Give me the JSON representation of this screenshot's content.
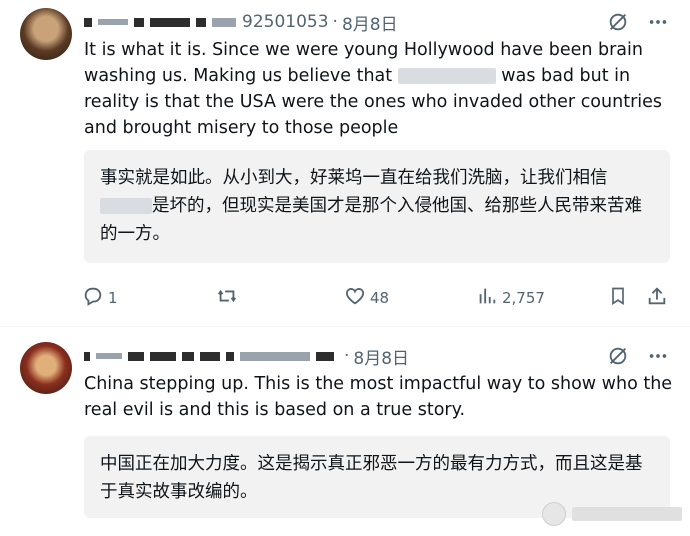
{
  "posts": [
    {
      "handle_visible": "92501053",
      "date": "8月8日",
      "text_parts": [
        "It is what it is.  Since we were young Hollywood have been brain washing us. Making us believe that ",
        " was bad but in reality is that the USA were the ones who invaded other countries and brought misery to those people"
      ],
      "translation_parts": [
        "事实就是如此。从小到大，好莱坞一直在给我们洗脑，让我们相信",
        "是坏的，但现实是美国才是那个入侵他国、给那些人民带来苦难的一方。"
      ],
      "actions": {
        "replies": "1",
        "reposts": "",
        "likes": "48",
        "views": "2,757"
      }
    },
    {
      "handle_visible": "",
      "date": "8月8日",
      "text": "China stepping up. This is the most impactful way to show who the real evil is and this is based on a true story.",
      "translation": "中国正在加大力度。这是揭示真正邪恶一方的最有力方式，而且这是基于真实故事改编的。"
    }
  ],
  "icons": {
    "grok": "grok-icon",
    "more": "more-icon",
    "reply": "reply-icon",
    "repost": "repost-icon",
    "like": "heart-icon",
    "views": "views-icon",
    "bookmark": "bookmark-icon",
    "share": "share-icon"
  },
  "colors": {
    "text": "#0f1419",
    "muted": "#536471",
    "translation_bg": "#f2f2f2"
  }
}
